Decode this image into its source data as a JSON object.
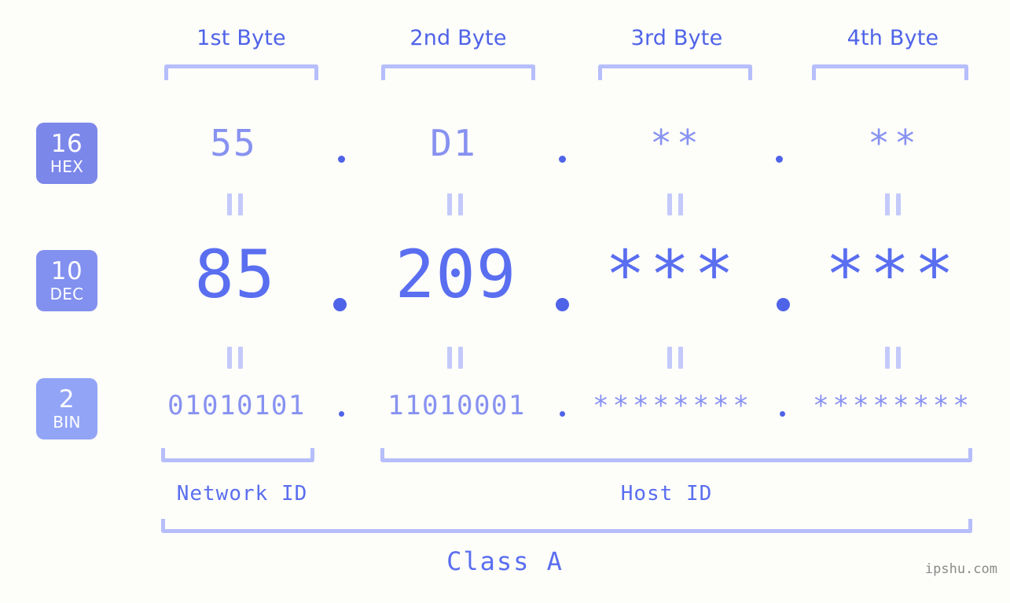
{
  "meta": {
    "background_color": "#fdfdfa",
    "accent_color": "#5a6ef0",
    "light_accent_color": "#b6befb",
    "value_color": "#8792f0",
    "watermark": "ipshu.com"
  },
  "headers": [
    {
      "label": "1st Byte"
    },
    {
      "label": "2nd Byte"
    },
    {
      "label": "3rd Byte"
    },
    {
      "label": "4th Byte"
    }
  ],
  "bases": [
    {
      "number": "16",
      "name": "HEX",
      "color": "#7c87ea"
    },
    {
      "number": "10",
      "name": "DEC",
      "color": "#8290ef"
    },
    {
      "number": "2",
      "name": "BIN",
      "color": "#92a4f6"
    }
  ],
  "rows": {
    "hex": {
      "base_number": "16",
      "base_name": "HEX",
      "values": [
        "55",
        "D1",
        "**",
        "**"
      ],
      "separator": "."
    },
    "dec": {
      "base_number": "10",
      "base_name": "DEC",
      "values": [
        "85",
        "209",
        "***",
        "***"
      ],
      "separator": "."
    },
    "bin": {
      "base_number": "2",
      "base_name": "BIN",
      "values": [
        "01010101",
        "11010001",
        "********",
        "********"
      ],
      "separator": "."
    }
  },
  "equals_marks": {
    "symbol": "||",
    "count": 8
  },
  "sections": [
    {
      "label": "Network ID"
    },
    {
      "label": "Host ID"
    }
  ],
  "class": {
    "label": "Class A"
  },
  "addresses": {
    "hex_full": "55.D1.**.**",
    "dec_full": "85.209.***.***",
    "bin_full": "01010101.11010001.********.********"
  }
}
